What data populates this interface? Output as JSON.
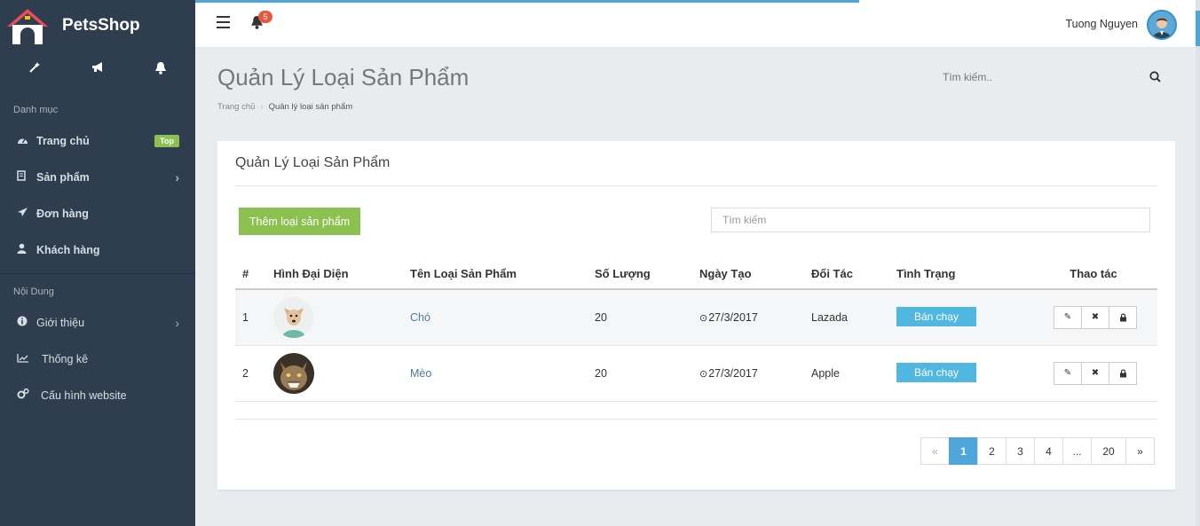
{
  "brand": {
    "name": "PetsShop"
  },
  "topbar": {
    "notification_count": "5",
    "user_name": "Tuong Nguyen"
  },
  "sidebar": {
    "section1_title": "Danh mục",
    "section2_title": "Nội Dung",
    "items": [
      {
        "label": "Trang chủ",
        "badge": "Top"
      },
      {
        "label": "Sản phẩm"
      },
      {
        "label": "Đơn hàng"
      },
      {
        "label": "Khách hàng"
      },
      {
        "label": "Giới thiệu"
      },
      {
        "label": "Thống kê"
      },
      {
        "label": "Cấu hình website"
      }
    ]
  },
  "page": {
    "title": "Quản Lý Loại Sản Phẩm",
    "breadcrumb_home": "Trang chủ",
    "breadcrumb_current": "Quản lý loại sản phẩm",
    "search_placeholder": "Tìm kiếm.."
  },
  "panel": {
    "title": "Quản Lý Loại Sản Phẩm",
    "add_button": "Thêm loại sản phẩm",
    "search_placeholder": "Tìm kiếm"
  },
  "table": {
    "headers": [
      "#",
      "Hình Đại Diện",
      "Tên Loại Sản Phẩm",
      "Số Lượng",
      "Ngày Tạo",
      "Đối Tác",
      "Tình Trạng",
      "Thao tác"
    ],
    "rows": [
      {
        "num": "1",
        "name": "Chó",
        "qty": "20",
        "date": "27/3/2017",
        "partner": "Lazada",
        "status": "Bán chạy"
      },
      {
        "num": "2",
        "name": "Mèo",
        "qty": "20",
        "date": "27/3/2017",
        "partner": "Apple",
        "status": "Bán chạy"
      }
    ]
  },
  "pagination": {
    "prev": "«",
    "pages": [
      "1",
      "2",
      "3",
      "4",
      "...",
      "20"
    ],
    "next": "»",
    "active": "1"
  },
  "colors": {
    "sidebar": "#2f3e4e",
    "accent_green": "#8cc152",
    "accent_blue": "#4fa7d9",
    "status_blue": "#4fb7e0"
  }
}
